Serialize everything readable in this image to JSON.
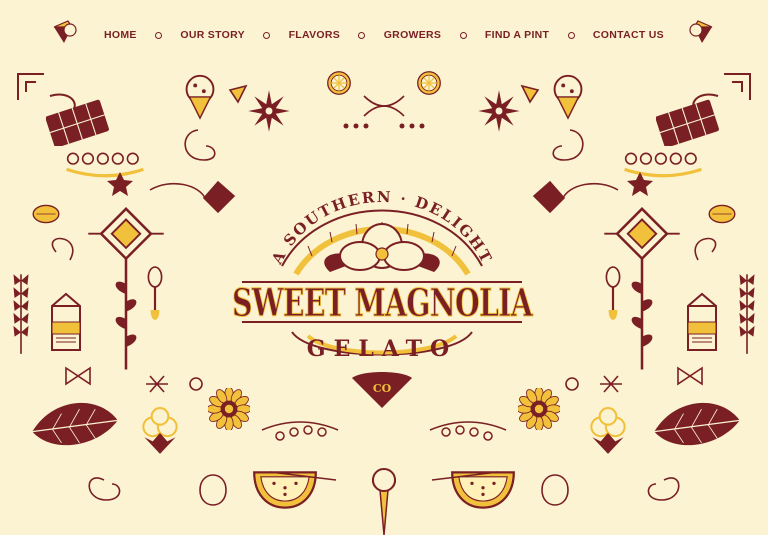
{
  "nav": {
    "items": [
      {
        "label": "HOME"
      },
      {
        "label": "OUR STORY"
      },
      {
        "label": "FLAVORS"
      },
      {
        "label": "GROWERS"
      },
      {
        "label": "FIND A PINT"
      },
      {
        "label": "CONTACT US"
      }
    ]
  },
  "logo": {
    "tagline": "A SOUTHERN · DELIGHT",
    "name": "SWEET MAGNOLIA",
    "product": "GELATO",
    "suffix": "CO"
  },
  "colors": {
    "background": "#fbf3d2",
    "maroon": "#7a1f24",
    "gold": "#f1c13c",
    "cream": "#fff4c4"
  }
}
